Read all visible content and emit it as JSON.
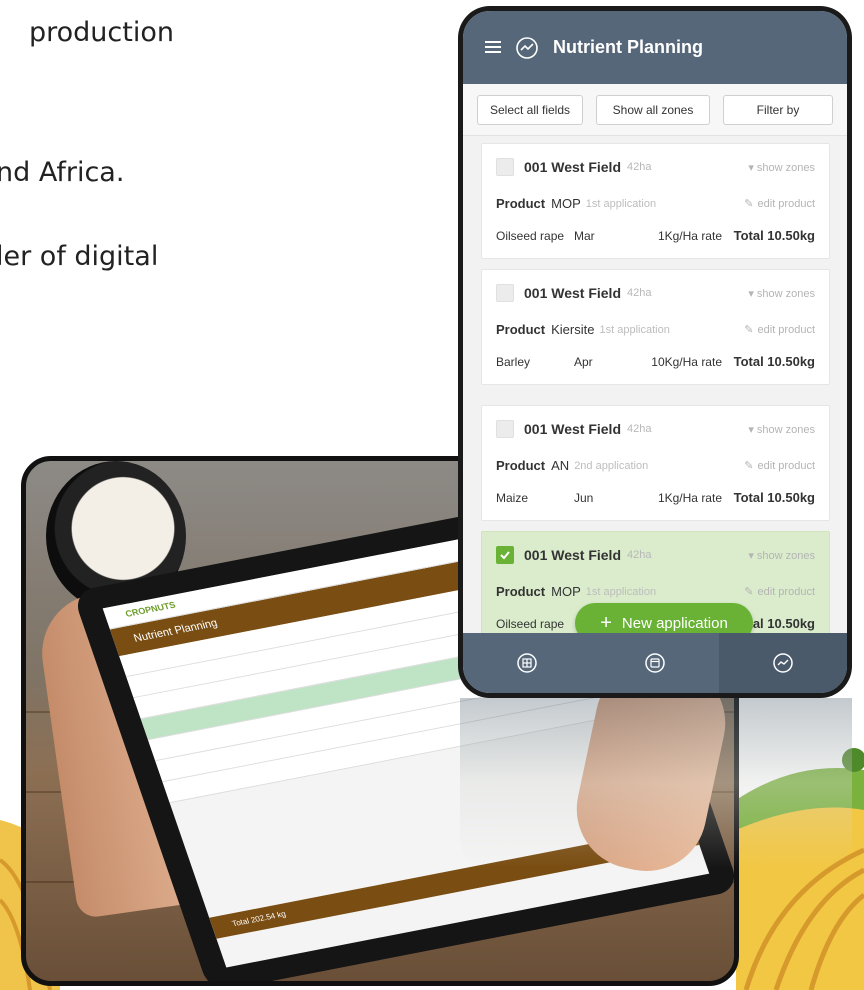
{
  "slide": {
    "line1": "production",
    "line2": "nd Africa.",
    "line3": "ler of digital"
  },
  "tablet": {
    "logo": "CROPNUTS",
    "header_title": "Nutrient Planning",
    "total_label": "Total    202.54 kg"
  },
  "app": {
    "title": "Nutrient Planning",
    "filters": {
      "select_all": "Select all fields",
      "show_all_zones": "Show all zones",
      "filter_by": "Filter by"
    },
    "cards": [
      {
        "field": "001 West Field",
        "area": "42ha",
        "show_zones": "show zones",
        "product_label": "Product",
        "product": "MOP",
        "application": "1st application",
        "edit": "edit product",
        "crop": "Oilseed rape",
        "month": "Mar",
        "rate": "1Kg/Ha rate",
        "total": "Total 10.50kg",
        "checked": false
      },
      {
        "field": "001 West Field",
        "area": "42ha",
        "show_zones": "show zones",
        "product_label": "Product",
        "product": "Kiersite",
        "application": "1st application",
        "edit": "edit product",
        "crop": "Barley",
        "month": "Apr",
        "rate": "10Kg/Ha rate",
        "total": "Total 10.50kg",
        "checked": false
      },
      {
        "field": "001 West Field",
        "area": "42ha",
        "show_zones": "show zones",
        "product_label": "Product",
        "product": "AN",
        "application": "2nd application",
        "edit": "edit product",
        "crop": "Maize",
        "month": "Jun",
        "rate": "1Kg/Ha rate",
        "total": "Total 10.50kg",
        "checked": false
      },
      {
        "field": "001 West Field",
        "area": "42ha",
        "show_zones": "show zones",
        "product_label": "Product",
        "product": "MOP",
        "application": "1st application",
        "edit": "edit product",
        "crop": "Oilseed rape",
        "month": "",
        "rate": "",
        "total": "tal 10.50kg",
        "checked": true
      }
    ],
    "fab_label": "New application",
    "nav": [
      {
        "icon": "globe-grid-icon",
        "active": false
      },
      {
        "icon": "calendar-icon",
        "active": false
      },
      {
        "icon": "chart-line-icon",
        "active": true
      }
    ],
    "colors": {
      "header": "#56677a",
      "accent_green": "#6ab236",
      "selected_card": "#daeccc",
      "tablet_brown": "#7a4d12"
    }
  }
}
